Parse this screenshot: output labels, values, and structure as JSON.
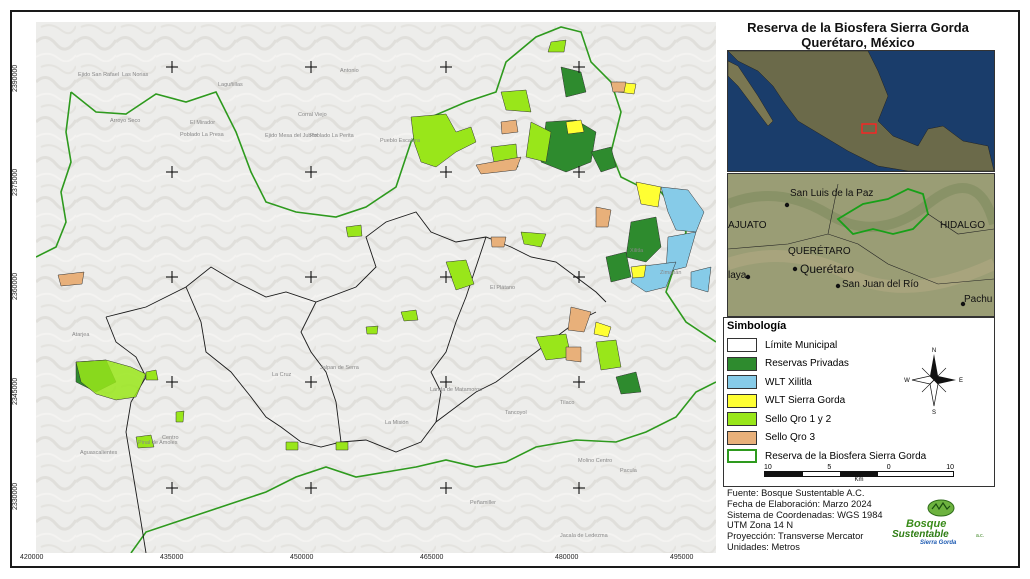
{
  "title": {
    "line1": "Reserva de la Biosfera Sierra Gorda",
    "line2": "Querétaro, México"
  },
  "axes": {
    "y_ticks": [
      "2390000",
      "2375000",
      "2360000",
      "2345000",
      "2330000"
    ],
    "x_ticks": [
      "420000",
      "435000",
      "450000",
      "465000",
      "480000",
      "495000"
    ]
  },
  "map_labels": [
    "Ejido San Rafael",
    "Las Norias",
    "Laguñillas",
    "Arroyo Seco",
    "El Mirador",
    "Poblado La Presa",
    "Ejido Mesa del Jubón",
    "Poblado La Perita",
    "Corral Viejo",
    "Pueblo Escalera",
    "Antonio",
    "Atarjea",
    "Jalpan de Serra",
    "La Cruz",
    "Landa de Matamoros",
    "Pinal de Amoles",
    "Centro",
    "Tancoyol",
    "Tilaco",
    "Peñamiller",
    "Xilitla",
    "Jacala de Ledezma",
    "Pacula",
    "Aguascalientes",
    "Molino Centro",
    "La Misión",
    "Zimapán",
    "El Plátano"
  ],
  "inset_labels": {
    "san_luis": "San Luis de la Paz",
    "guanajuato": "AJUATO",
    "hidalgo": "HIDALGO",
    "queretaro_state": "QUERÉTARO",
    "queretaro_city": "Querétaro",
    "san_juan": "San Juan del Río",
    "laya": "laya",
    "pachu": "Pachu"
  },
  "legend": {
    "title": "Simbología",
    "items": [
      {
        "label": "Límite Municipal",
        "color": "#ffffff"
      },
      {
        "label": "Reservas Privadas",
        "color": "#2e8b2e"
      },
      {
        "label": "WLT Xilitla",
        "color": "#86cbe8"
      },
      {
        "label": "WLT Sierra Gorda",
        "color": "#ffff33"
      },
      {
        "label": "Sello Qro 1 y 2",
        "color": "#99e61a"
      },
      {
        "label": "Sello Qro 3",
        "color": "#e8b07a"
      },
      {
        "label": "Reserva de la Biosfera Sierra Gorda",
        "color": "#ffffff",
        "border": "#2e9a1e"
      }
    ],
    "scale_labels": [
      "10",
      "5",
      "0",
      "10"
    ],
    "scale_unit": "Km",
    "north_letters": {
      "n": "N",
      "s": "S",
      "e": "E",
      "w": "W"
    }
  },
  "source": {
    "lines": [
      "Fuente: Bosque Sustentable A.C.",
      "Fecha de Elaboración: Marzo 2024",
      "Sistema de Coordenadas: WGS 1984",
      "UTM Zona 14 N",
      "Proyección: Transverse Mercator",
      "Unidades: Metros"
    ]
  },
  "logo": {
    "line1": "Bosque",
    "line2": "Sustentable",
    "suffix": "a.c.",
    "line3": "Sierra Gorda"
  },
  "colors": {
    "reserve_boundary": "#2e9a1e",
    "reservas_privadas": "#2e8b2e",
    "wlt_xilitla": "#86cbe8",
    "wlt_sierra_gorda": "#ffff33",
    "sello_1_2": "#99e61a",
    "sello_3": "#e8b07a"
  }
}
